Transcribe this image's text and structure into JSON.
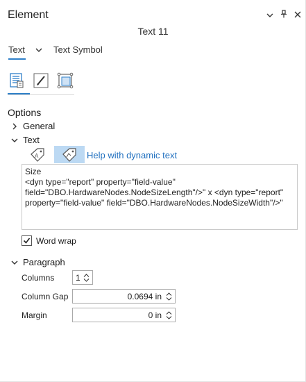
{
  "pane": {
    "title": "Element"
  },
  "element_name": "Text 11",
  "tabs": {
    "active": "Text",
    "other": "Text Symbol"
  },
  "options": {
    "label": "Options",
    "general": "General",
    "text": "Text",
    "help_link": "Help with dynamic text",
    "text_content": "Size\n<dyn type=\"report\" property=\"field-value\" field=\"DBO.HardwareNodes.NodeSizeLength\"/>\" x <dyn type=\"report\" property=\"field-value\" field=\"DBO.HardwareNodes.NodeSizeWidth\"/>\"",
    "word_wrap": {
      "label": "Word wrap",
      "checked": true
    }
  },
  "paragraph": {
    "label": "Paragraph",
    "columns": {
      "label": "Columns",
      "value": "1"
    },
    "column_gap": {
      "label": "Column Gap",
      "value": "0.0694 in"
    },
    "margin": {
      "label": "Margin",
      "value": "0 in"
    }
  },
  "colors": {
    "accent": "#2f80c9",
    "link": "#1f6fbf",
    "selected_icon_bg": "#bcd9f3"
  }
}
